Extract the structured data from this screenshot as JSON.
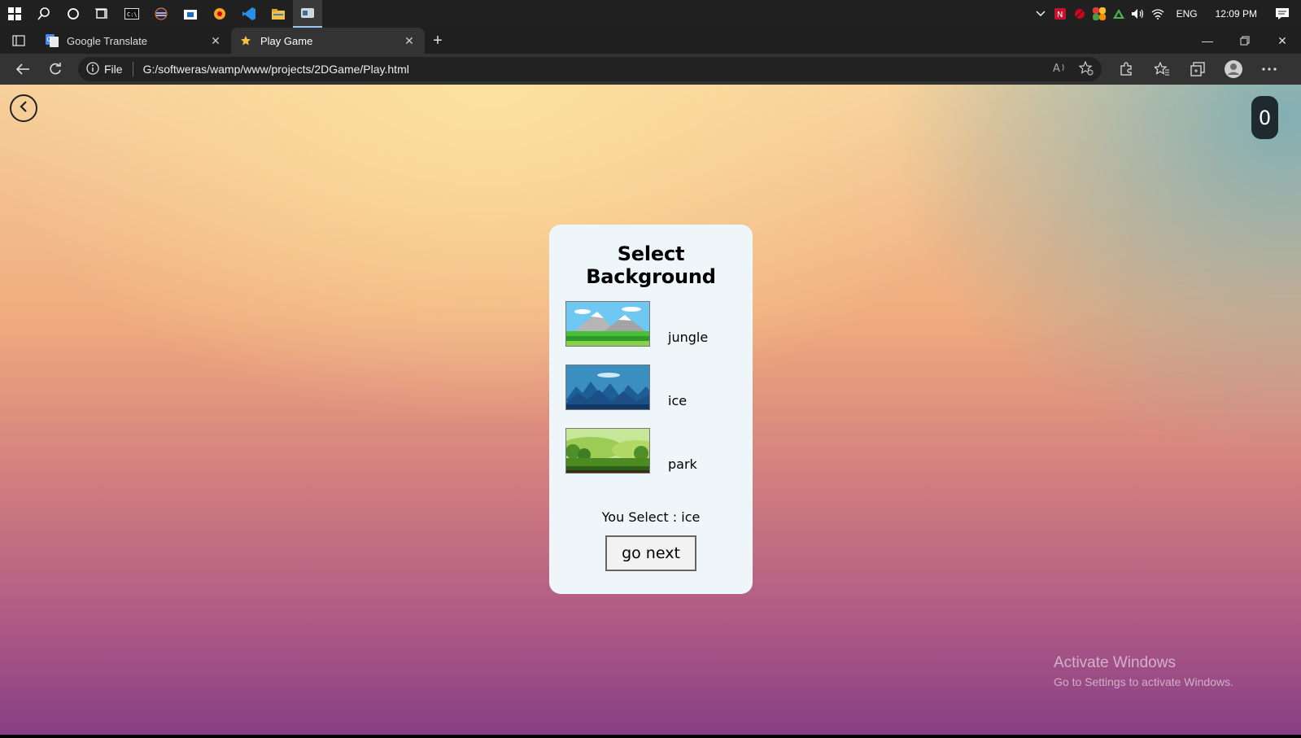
{
  "taskbar": {
    "apps": [
      "start-icon",
      "search-icon",
      "cortana-icon",
      "task-view-icon",
      "terminal-icon",
      "eclipse-icon",
      "store-icon",
      "firefox-icon",
      "vscode-icon",
      "file-explorer-icon",
      "browser-icon"
    ],
    "tray": {
      "language": "ENG",
      "time": "12:09 PM"
    }
  },
  "tabs": [
    {
      "title": "Google Translate",
      "favicon": "google-translate-icon",
      "active": false
    },
    {
      "title": "Play Game",
      "favicon": "star-icon",
      "active": true
    }
  ],
  "address_bar": {
    "scheme_label": "File",
    "url": "G:/softweras/wamp/www/projects/2DGame/Play.html"
  },
  "page": {
    "score": "0",
    "title": "Select Background",
    "options": [
      {
        "label": "jungle",
        "thumbnail": "mountain-grass-scene"
      },
      {
        "label": "ice",
        "thumbnail": "blue-ice-mountain-scene"
      },
      {
        "label": "park",
        "thumbnail": "green-hills-forest-scene"
      }
    ],
    "selected_text": "You Select : ice",
    "go_next_label": "go next"
  },
  "watermark": {
    "line1": "Activate Windows",
    "line2": "Go to Settings to activate Windows."
  },
  "colors": {
    "card_bg": "#eef6fa",
    "score_bg": "#1e2a2e",
    "gradient_top": "#fde2a0",
    "gradient_bottom": "#873f84"
  }
}
